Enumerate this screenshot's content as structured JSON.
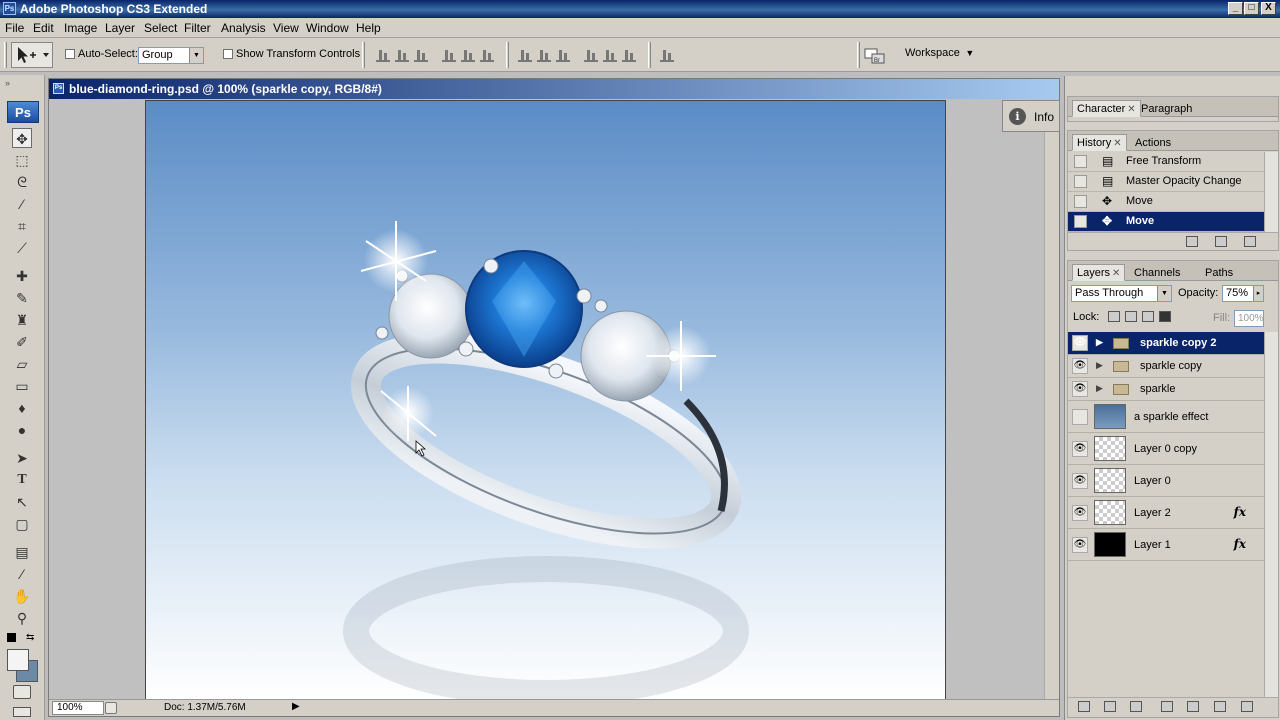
{
  "app": {
    "title": "Adobe Photoshop CS3 Extended",
    "icon": "ps-app-icon"
  },
  "window_controls": {
    "minimize": "_",
    "maximize": "□",
    "close": "X"
  },
  "menu": [
    "File",
    "Edit",
    "Image",
    "Layer",
    "Select",
    "Filter",
    "Analysis",
    "View",
    "Window",
    "Help"
  ],
  "options": {
    "auto_select_label": "Auto-Select:",
    "auto_select_checked": false,
    "auto_select_value": "Group",
    "show_transform_label": "Show Transform Controls",
    "show_transform_checked": false,
    "workspace_label": "Workspace"
  },
  "tools": [
    "move",
    "marquee",
    "lasso",
    "magic-wand",
    "crop",
    "slice",
    "healing-brush",
    "brush",
    "clone-stamp",
    "history-brush",
    "eraser",
    "gradient",
    "blur",
    "dodge",
    "path-selection",
    "type",
    "direct-selection",
    "shape",
    "notes",
    "eyedropper",
    "hand",
    "zoom"
  ],
  "toolbox": {
    "logo": "Ps"
  },
  "document": {
    "title": "blue-diamond-ring.psd @ 100% (sparkle copy, RGB/8#)",
    "zoom": "100%",
    "doc_size": "Doc: 1.37M/5.76M"
  },
  "info_dock": {
    "label": "Info",
    "icon": "i"
  },
  "panels": {
    "character_tabs": [
      "Character",
      "Paragraph"
    ],
    "history_tabs": [
      "History",
      "Actions"
    ],
    "history": [
      {
        "label": "Free Transform",
        "icon": "transform-icon",
        "selected": false
      },
      {
        "label": "Master Opacity Change",
        "icon": "opacity-icon",
        "selected": false
      },
      {
        "label": "Move",
        "icon": "move-icon",
        "selected": false
      },
      {
        "label": "Move",
        "icon": "move-icon",
        "selected": true
      }
    ],
    "layers_tabs": [
      "Layers",
      "Channels",
      "Paths"
    ],
    "blend_mode": "Pass Through",
    "opacity_label": "Opacity:",
    "opacity_value": "75%",
    "lock_label": "Lock:",
    "fill_label": "Fill:",
    "fill_value": "100%",
    "layers": [
      {
        "name": "sparkle copy 2",
        "kind": "group",
        "visible": true,
        "selected": true,
        "fx": ""
      },
      {
        "name": "sparkle copy",
        "kind": "group",
        "visible": true,
        "selected": false,
        "fx": ""
      },
      {
        "name": "sparkle",
        "kind": "group",
        "visible": true,
        "selected": false,
        "fx": ""
      },
      {
        "name": "a sparkle effect",
        "kind": "image",
        "visible": false,
        "selected": false,
        "fx": ""
      },
      {
        "name": "Layer 0 copy",
        "kind": "transparent",
        "visible": true,
        "selected": false,
        "fx": ""
      },
      {
        "name": "Layer 0",
        "kind": "transparent",
        "visible": true,
        "selected": false,
        "fx": ""
      },
      {
        "name": "Layer 2",
        "kind": "transparent",
        "visible": true,
        "selected": false,
        "fx": "fx"
      },
      {
        "name": "Layer 1",
        "kind": "black",
        "visible": true,
        "selected": false,
        "fx": "fx"
      }
    ]
  }
}
